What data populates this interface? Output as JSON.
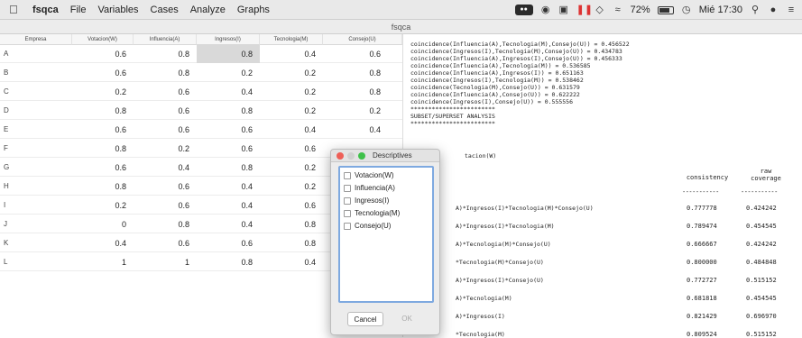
{
  "menubar": {
    "app": "fsqca",
    "items": [
      "File",
      "Variables",
      "Cases",
      "Analyze",
      "Graphs"
    ],
    "battery": "72%",
    "clock": "Mié 17:30"
  },
  "window": {
    "title": "fsqca"
  },
  "table": {
    "columns": [
      "Empresa",
      "Votacion(W)",
      "Influencia(A)",
      "Ingresos(I)",
      "Tecnologia(M)",
      "Consejo(U)"
    ],
    "rows": [
      {
        "label": "A",
        "values": [
          "0.6",
          "0.8",
          "0.8",
          "0.4",
          "0.6"
        ]
      },
      {
        "label": "B",
        "values": [
          "0.6",
          "0.8",
          "0.2",
          "0.2",
          "0.8"
        ]
      },
      {
        "label": "C",
        "values": [
          "0.2",
          "0.6",
          "0.4",
          "0.2",
          "0.8"
        ]
      },
      {
        "label": "D",
        "values": [
          "0.8",
          "0.6",
          "0.8",
          "0.2",
          "0.2"
        ]
      },
      {
        "label": "E",
        "values": [
          "0.6",
          "0.6",
          "0.6",
          "0.4",
          "0.4"
        ]
      },
      {
        "label": "F",
        "values": [
          "0.8",
          "0.2",
          "0.6",
          "0.6",
          ""
        ]
      },
      {
        "label": "G",
        "values": [
          "0.6",
          "0.4",
          "0.8",
          "0.2",
          ""
        ]
      },
      {
        "label": "H",
        "values": [
          "0.8",
          "0.6",
          "0.4",
          "0.2",
          ""
        ]
      },
      {
        "label": "I",
        "values": [
          "0.2",
          "0.6",
          "0.4",
          "0.6",
          ""
        ]
      },
      {
        "label": "J",
        "values": [
          "0",
          "0.8",
          "0.4",
          "0.8",
          ""
        ]
      },
      {
        "label": "K",
        "values": [
          "0.4",
          "0.6",
          "0.6",
          "0.8",
          ""
        ]
      },
      {
        "label": "L",
        "values": [
          "1",
          "1",
          "0.8",
          "0.4",
          ""
        ]
      }
    ]
  },
  "output": {
    "lines": [
      "coincidence(Influencia(A),Tecnologia(M),Consejo(U)) = 0.456522",
      "coincidence(Ingresos(I),Tecnologia(M),Consejo(U)) = 0.434783",
      "coincidence(Influencia(A),Ingresos(I),Consejo(U)) = 0.456333",
      "coincidence(Influencia(A),Tecnologia(M)) = 0.536585",
      "coincidence(Influencia(A),Ingresos(I)) = 0.651163",
      "coincidence(Ingresos(I),Tecnologia(M)) = 0.538462",
      "coincidence(Tecnologia(M),Consejo(U)) = 0.631579",
      "coincidence(Influencia(A),Consejo(U)) = 0.622222",
      "coincidence(Ingresos(I),Consejo(U)) = 0.555556",
      "************************",
      "SUBSET/SUPERSET ANALYSIS",
      "************************"
    ],
    "outcome": "tacion(W)",
    "col_consistency": "consistency",
    "col_raw": "raw",
    "col_coverage": "coverage",
    "dash": "-----------",
    "rows": [
      {
        "term": "A)*Ingresos(I)*Tecnologia(M)*Consejo(U)",
        "consistency": "0.777778",
        "coverage": "0.424242"
      },
      {
        "term": "A)*Ingresos(I)*Tecnologia(M)",
        "consistency": "0.789474",
        "coverage": "0.454545"
      },
      {
        "term": "A)*Tecnologia(M)*Consejo(U)",
        "consistency": "0.666667",
        "coverage": "0.424242"
      },
      {
        "term": "*Tecnologia(M)*Consejo(U)",
        "consistency": "0.800000",
        "coverage": "0.484848"
      },
      {
        "term": "A)*Ingresos(I)*Consejo(U)",
        "consistency": "0.772727",
        "coverage": "0.515152"
      },
      {
        "term": "A)*Tecnologia(M)",
        "consistency": "0.681818",
        "coverage": "0.454545"
      },
      {
        "term": "A)*Ingresos(I)",
        "consistency": "0.821429",
        "coverage": "0.696970"
      },
      {
        "term": "*Tecnologia(M)",
        "consistency": "0.809524",
        "coverage": "0.515152"
      }
    ]
  },
  "dialog": {
    "title": "Descriptives",
    "items": [
      "Votacion(W)",
      "Influencia(A)",
      "Ingresos(I)",
      "Tecnologia(M)",
      "Consejo(U)"
    ],
    "cancel": "Cancel",
    "ok": "OK"
  }
}
